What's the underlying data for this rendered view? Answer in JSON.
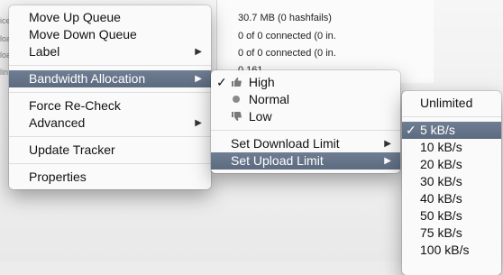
{
  "background": {
    "rows": [
      {
        "text": "30.7 MB (0 hashfails)"
      },
      {
        "text": "0 of 0 connected (0 in."
      },
      {
        "text": "0 of 0 connected (0 in."
      },
      {
        "text": "0.161"
      }
    ],
    "left_fragments": [
      "ice",
      "load",
      "load",
      "lin"
    ]
  },
  "context_menu": {
    "items": [
      {
        "label": "Move Up Queue"
      },
      {
        "label": "Move Down Queue"
      },
      {
        "label": "Label"
      },
      {
        "label": "Bandwidth Allocation"
      },
      {
        "label": "Force Re-Check"
      },
      {
        "label": "Advanced"
      },
      {
        "label": "Update Tracker"
      },
      {
        "label": "Properties"
      }
    ]
  },
  "bandwidth_menu": {
    "items": [
      {
        "label": "High",
        "checked": true,
        "icon": "thumbs-up-icon"
      },
      {
        "label": "Normal",
        "checked": false,
        "icon": "dot-icon"
      },
      {
        "label": "Low",
        "checked": false,
        "icon": "thumbs-down-icon"
      },
      {
        "label": "Set Download Limit"
      },
      {
        "label": "Set Upload Limit"
      }
    ]
  },
  "upload_limit_menu": {
    "items": [
      {
        "label": "Unlimited"
      },
      {
        "label": "5 kB/s",
        "checked": true
      },
      {
        "label": "10 kB/s"
      },
      {
        "label": "20 kB/s"
      },
      {
        "label": "30 kB/s"
      },
      {
        "label": "40 kB/s"
      },
      {
        "label": "50 kB/s"
      },
      {
        "label": "75 kB/s"
      },
      {
        "label": "100 kB/s"
      }
    ]
  },
  "glyphs": {
    "submenu_arrow": "▶",
    "check": "✓"
  },
  "colors": {
    "highlight": "#65748a"
  }
}
